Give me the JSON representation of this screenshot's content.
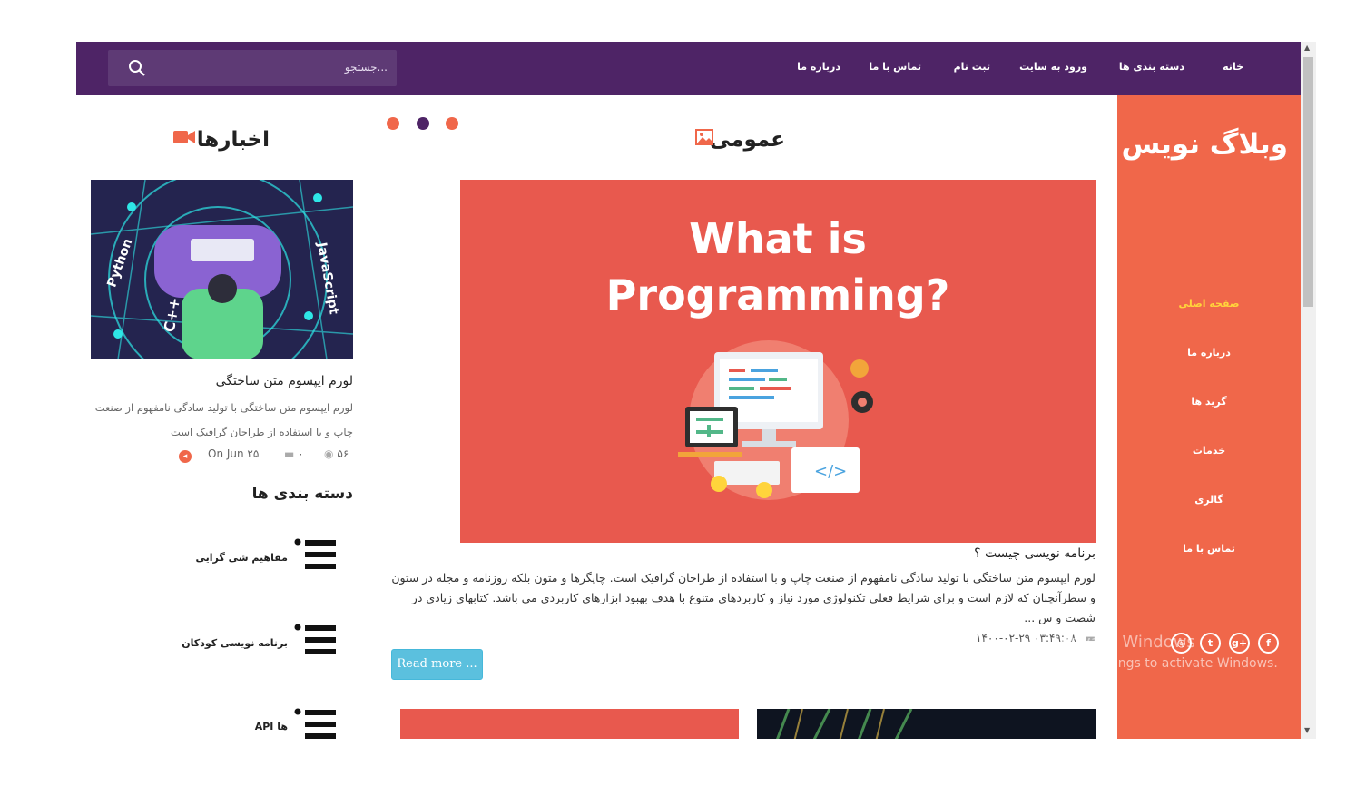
{
  "nav": {
    "search_placeholder": "جستجو...",
    "items": [
      {
        "label": "خانه"
      },
      {
        "label": "دسته بندی ها"
      },
      {
        "label": "ورود به سایت"
      },
      {
        "label": "ثبت نام"
      },
      {
        "label": "تماس با ما"
      },
      {
        "label": "درباره ما"
      }
    ]
  },
  "sidebar": {
    "brand": "وبلاگ نویس",
    "menu": [
      {
        "label": "صفحه اصلی",
        "active": true
      },
      {
        "label": "درباره ما"
      },
      {
        "label": "گرید ها"
      },
      {
        "label": "خدمات"
      },
      {
        "label": "گالری"
      },
      {
        "label": "تماس با ما"
      }
    ],
    "social": [
      {
        "icon": "facebook-icon",
        "glyph": "f"
      },
      {
        "icon": "google-plus-icon",
        "glyph": "g+"
      },
      {
        "icon": "twitter-icon",
        "glyph": "t"
      },
      {
        "icon": "dribbble-icon",
        "glyph": "◎"
      }
    ]
  },
  "main": {
    "section_title": "عمومی",
    "section_icon": "image-icon",
    "slider_dots": [
      "#f0674a",
      "#4e2466",
      "#f0674a"
    ],
    "hero": {
      "line1": "What is",
      "line2": "Programming?"
    },
    "post": {
      "title": "برنامه نویسی چیست ؟",
      "body": "لورم ایپسوم متن ساختگی با تولید سادگی نامفهوم از صنعت چاپ و با استفاده از طراحان گرافیک است. چاپگرها و متون بلکه روزنامه و مجله در ستون و سطرآنچنان که لازم است و برای شرایط فعلی تکنولوژی مورد نیاز و کاربردهای متنوع با هدف بهبود ابزارهای کاربردی می باشد. کتابهای زیادی در شصت و س ...",
      "date": "۱۴۰۰-۰۲-۲۹ ۰۳:۴۹:۰۸",
      "read_more": "Read more ..."
    }
  },
  "left": {
    "news_title": "اخبارها",
    "news_icon": "video-camera-icon",
    "news_item": {
      "title": "لورم ایپسوم متن ساختگی",
      "excerpt": "لورم ایپسوم متن ساختگی با تولید سادگی نامفهوم از صنعت چاپ و با استفاده از طراحان گرافیک است",
      "views": "۵۶",
      "comments": "۰",
      "date": "On Jun ۲۵"
    },
    "categories_title": "دسته بندی ها",
    "categories": [
      {
        "label": "مفاهیم شی گرایی"
      },
      {
        "label": "برنامه نویسی کودکان"
      },
      {
        "label": "API ها"
      }
    ]
  },
  "os_watermark": {
    "line1": "Activate Windows",
    "line2": "Go to Settings to activate Windows."
  },
  "colors": {
    "nav": "#4e2466",
    "sidebar": "#f0674a",
    "accent_active": "#ffd43b",
    "read_more": "#5bc0de"
  }
}
